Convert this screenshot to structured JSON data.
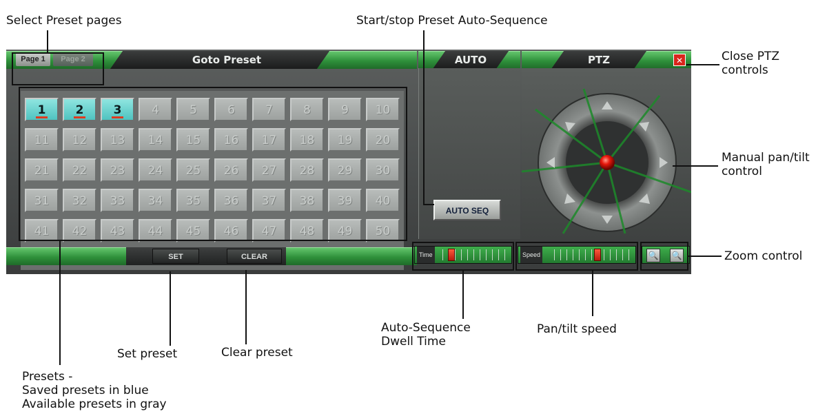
{
  "colors": {
    "bar_green": "#2e8f3a",
    "preset_saved": "#4fc3c0",
    "preset_available": "#9da19f",
    "knob_red": "#e0391f"
  },
  "callouts": {
    "select_preset_pages": "Select Preset pages",
    "start_stop_auto_sequence": "Start/stop Preset Auto-Sequence",
    "close_ptz": "Close PTZ\ncontrols",
    "manual_pan_tilt": "Manual pan/tilt\ncontrol",
    "zoom_control": "Zoom control",
    "dwell_time": "Auto-Sequence\nDwell Time",
    "pan_tilt_speed": "Pan/tilt speed",
    "set_preset": "Set preset",
    "clear_preset": "Clear preset",
    "presets": "Presets -\nSaved presets in blue\nAvailable presets in gray"
  },
  "ui": {
    "page_tabs": [
      "Page 1",
      "Page 2"
    ],
    "goto_preset_title": "Goto Preset",
    "auto_title": "AUTO",
    "ptz_title": "PTZ",
    "close_symbol": "✕",
    "auto_seq_label": "AUTO SEQ",
    "set_label": "SET",
    "clear_label": "CLEAR",
    "time_label": "Time",
    "speed_label": "Speed",
    "zoom_out_symbol": "🔍",
    "zoom_in_symbol": "🔍",
    "dwell_time_position": 0.05,
    "speed_position": 0.55
  },
  "presets": {
    "saved": [
      1,
      2,
      3
    ],
    "numbers": [
      "1",
      "2",
      "3",
      "4",
      "5",
      "6",
      "7",
      "8",
      "9",
      "10",
      "11",
      "12",
      "13",
      "14",
      "15",
      "16",
      "17",
      "18",
      "19",
      "20",
      "21",
      "22",
      "23",
      "24",
      "25",
      "26",
      "27",
      "28",
      "29",
      "30",
      "31",
      "32",
      "33",
      "34",
      "35",
      "36",
      "37",
      "38",
      "39",
      "40",
      "41",
      "42",
      "43",
      "44",
      "45",
      "46",
      "47",
      "48",
      "49",
      "50"
    ]
  },
  "joystick": {
    "arrow_icons": [
      "up-arrow-icon",
      "up-right-arrow-icon",
      "right-arrow-icon",
      "down-right-arrow-icon",
      "down-arrow-icon",
      "down-left-arrow-icon",
      "left-arrow-icon",
      "up-left-arrow-icon"
    ]
  }
}
